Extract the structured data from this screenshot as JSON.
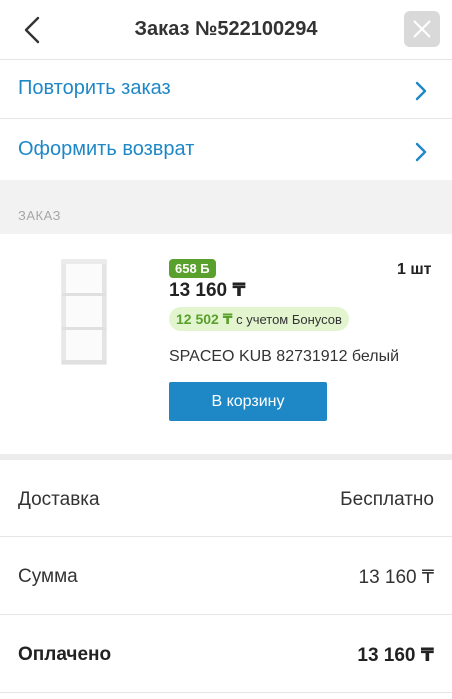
{
  "header": {
    "title": "Заказ №522100294",
    "back_icon": "chevron-left-icon",
    "close_icon": "close-icon"
  },
  "actions": [
    {
      "label": "Повторить заказ",
      "icon": "chevron-right-icon"
    },
    {
      "label": "Оформить возврат",
      "icon": "chevron-right-icon"
    }
  ],
  "order_section": {
    "label": "ЗАКАЗ"
  },
  "product": {
    "bonus_badge": "658 Б",
    "price": "13 160 ₸",
    "quantity": "1 шт",
    "bonus_price": "12 502 ₸",
    "bonus_note": "с учетом Бонусов",
    "name": "SPACEO KUB 82731912 белый",
    "cart_button": "В корзину",
    "image_icon": "shelf-product-image"
  },
  "summary": [
    {
      "label": "Доставка",
      "value": "Бесплатно"
    },
    {
      "label": "Сумма",
      "value": "13 160 ₸"
    },
    {
      "label": "Оплачено",
      "value": "13 160 ₸"
    }
  ],
  "colors": {
    "accent": "#1e88c7",
    "bonus_green": "#5aa02c",
    "bonus_pill_bg": "#e3f5cf",
    "section_gray": "#f2f2f2"
  }
}
